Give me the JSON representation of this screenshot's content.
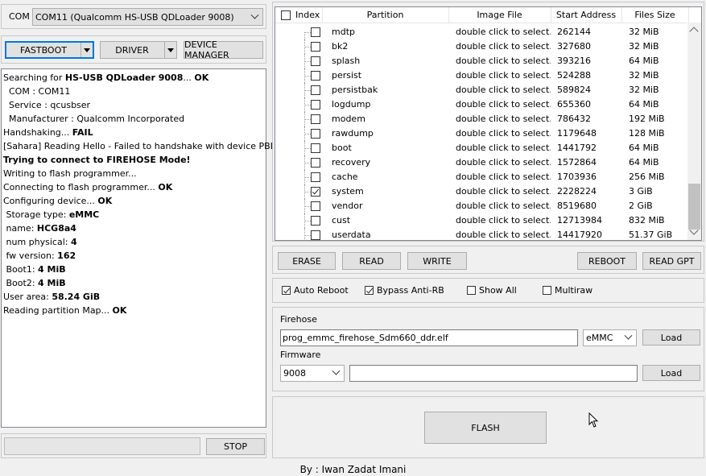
{
  "com": {
    "label": "COM",
    "selected": "COM11 (Qualcomm HS-USB QDLoader 9008)"
  },
  "toolbar": {
    "fastboot": "FASTBOOT",
    "driver": "DRIVER",
    "device_manager": "DEVICE MANAGER"
  },
  "log": [
    {
      "parts": [
        {
          "t": "Searching for "
        },
        {
          "t": "HS-USB QDLoader 9008",
          "b": true
        },
        {
          "t": "... "
        },
        {
          "t": "OK",
          "b": true
        }
      ]
    },
    {
      "parts": [
        {
          "t": "  COM : COM11"
        }
      ]
    },
    {
      "parts": [
        {
          "t": "  Service : qcusbser"
        }
      ]
    },
    {
      "parts": [
        {
          "t": "  Manufacturer : Qualcomm Incorporated"
        }
      ]
    },
    {
      "parts": [
        {
          "t": "Handshaking... "
        },
        {
          "t": "FAIL",
          "b": true
        }
      ]
    },
    {
      "parts": [
        {
          "t": "[Sahara] Reading Hello - Failed to handshake with device PBL!"
        }
      ]
    },
    {
      "parts": [
        {
          "t": "Trying to connect to FIREHOSE Mode!",
          "b": true
        }
      ]
    },
    {
      "parts": [
        {
          "t": "Writing to flash programmer..."
        }
      ]
    },
    {
      "parts": [
        {
          "t": "Connecting to flash programmer... "
        },
        {
          "t": "OK",
          "b": true
        }
      ]
    },
    {
      "parts": [
        {
          "t": "Configuring device... "
        },
        {
          "t": "OK",
          "b": true
        }
      ]
    },
    {
      "parts": [
        {
          "t": " Storage type: "
        },
        {
          "t": "eMMC",
          "b": true
        }
      ]
    },
    {
      "parts": [
        {
          "t": " name: "
        },
        {
          "t": "HCG8a4",
          "b": true
        }
      ]
    },
    {
      "parts": [
        {
          "t": " num physical: "
        },
        {
          "t": "4",
          "b": true
        }
      ]
    },
    {
      "parts": [
        {
          "t": " fw version: "
        },
        {
          "t": "162",
          "b": true
        }
      ]
    },
    {
      "parts": [
        {
          "t": " Boot1: "
        },
        {
          "t": "4 MiB",
          "b": true
        }
      ]
    },
    {
      "parts": [
        {
          "t": " Boot2: "
        },
        {
          "t": "4 MiB",
          "b": true
        }
      ]
    },
    {
      "parts": [
        {
          "t": "User area: "
        },
        {
          "t": "58.24 GiB",
          "b": true
        }
      ]
    },
    {
      "parts": [
        {
          "t": "Reading partition Map... "
        },
        {
          "t": "OK",
          "b": true
        }
      ]
    }
  ],
  "stop_button": "STOP",
  "table": {
    "headers": {
      "index": "Index",
      "partition": "Partition",
      "image": "Image File",
      "start": "Start Address",
      "size": "Files Size"
    },
    "rows": [
      {
        "p": "mdtp",
        "img": "double click to select...",
        "start": "262144",
        "size": "32 MiB",
        "checked": false
      },
      {
        "p": "bk2",
        "img": "double click to select...",
        "start": "327680",
        "size": "32 MiB",
        "checked": false
      },
      {
        "p": "splash",
        "img": "double click to select...",
        "start": "393216",
        "size": "64 MiB",
        "checked": false
      },
      {
        "p": "persist",
        "img": "double click to select...",
        "start": "524288",
        "size": "32 MiB",
        "checked": false
      },
      {
        "p": "persistbak",
        "img": "double click to select...",
        "start": "589824",
        "size": "32 MiB",
        "checked": false
      },
      {
        "p": "logdump",
        "img": "double click to select...",
        "start": "655360",
        "size": "64 MiB",
        "checked": false
      },
      {
        "p": "modem",
        "img": "double click to select...",
        "start": "786432",
        "size": "192 MiB",
        "checked": false
      },
      {
        "p": "rawdump",
        "img": "double click to select...",
        "start": "1179648",
        "size": "128 MiB",
        "checked": false
      },
      {
        "p": "boot",
        "img": "double click to select...",
        "start": "1441792",
        "size": "64 MiB",
        "checked": false
      },
      {
        "p": "recovery",
        "img": "double click to select...",
        "start": "1572864",
        "size": "64 MiB",
        "checked": false
      },
      {
        "p": "cache",
        "img": "double click to select...",
        "start": "1703936",
        "size": "256 MiB",
        "checked": false
      },
      {
        "p": "system",
        "img": "double click to select...",
        "start": "2228224",
        "size": "3 GiB",
        "checked": true
      },
      {
        "p": "vendor",
        "img": "double click to select...",
        "start": "8519680",
        "size": "2 GiB",
        "checked": false
      },
      {
        "p": "cust",
        "img": "double click to select...",
        "start": "12713984",
        "size": "832 MiB",
        "checked": false
      },
      {
        "p": "userdata",
        "img": "double click to select...",
        "start": "14417920",
        "size": "51.37 GiB",
        "checked": false
      }
    ]
  },
  "actions": {
    "erase": "ERASE",
    "read": "READ",
    "write": "WRITE",
    "reboot": "REBOOT",
    "read_gpt": "READ GPT"
  },
  "options": {
    "auto_reboot": "Auto Reboot",
    "bypass": "Bypass Anti-RB",
    "show_all": "Show All",
    "multiraw": "Multiraw"
  },
  "firehose": {
    "label": "Firehose",
    "file": "prog_emmc_firehose_Sdm660_ddr.elf",
    "storage": "eMMC",
    "load": "Load"
  },
  "firmware": {
    "label": "Firmware",
    "version": "9008",
    "path": "",
    "load": "Load"
  },
  "flash": "FLASH",
  "footer": "By : Iwan Zadat Imani"
}
